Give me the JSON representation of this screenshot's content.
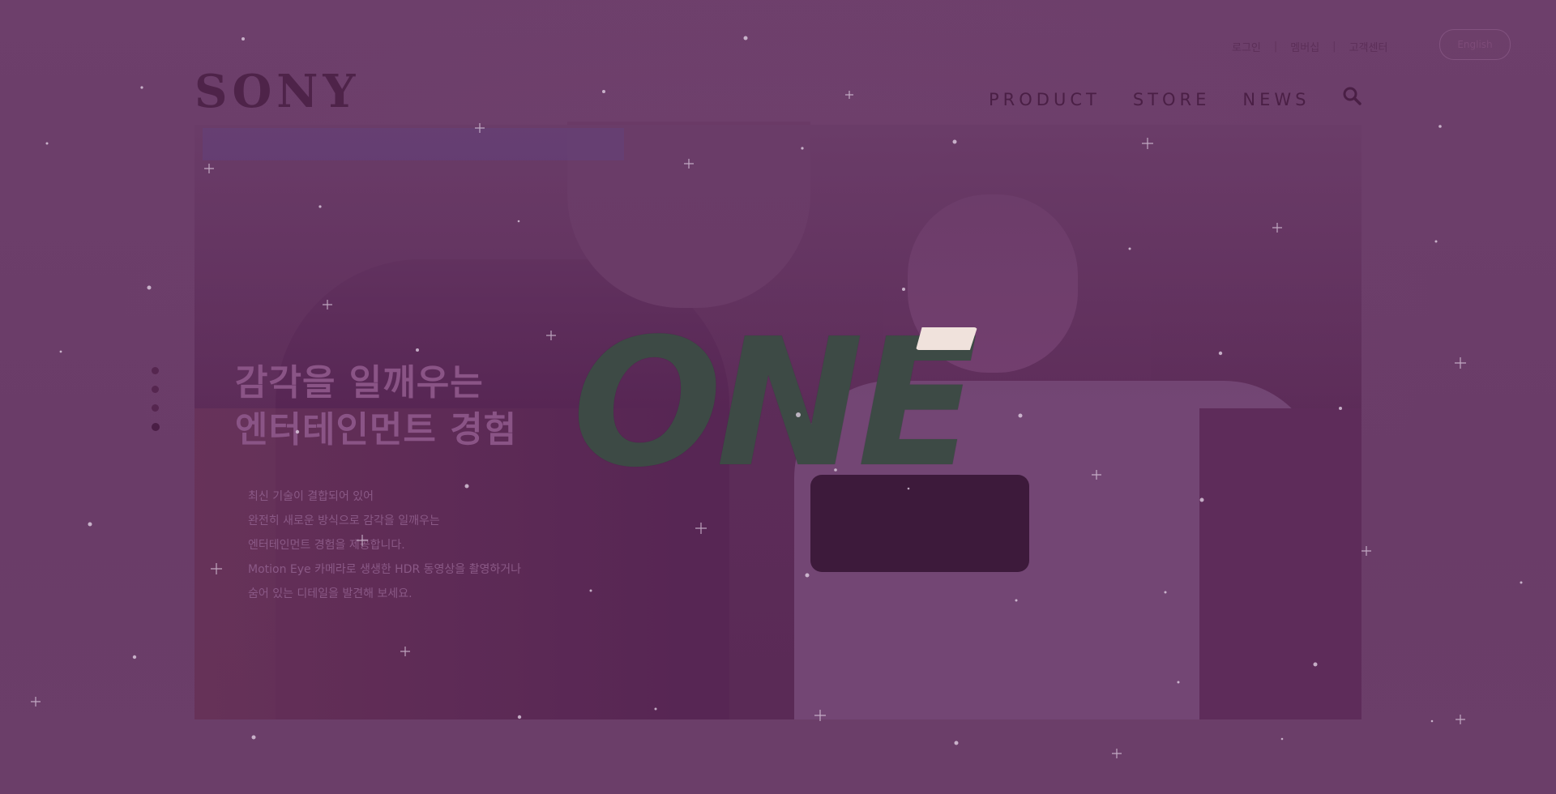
{
  "brand": {
    "logo_text": "SONY"
  },
  "top_links": {
    "login": "로그인",
    "membership": "멤버십",
    "support": "고객센터",
    "separator": "|"
  },
  "lang_button": {
    "label": "English"
  },
  "nav": {
    "items": [
      "PRODUCT",
      "STORE",
      "NEWS"
    ]
  },
  "hero": {
    "headline_line1": "감각을 일깨우는",
    "headline_line2": "엔터테인먼트 경험",
    "big_word": "ONE",
    "description": [
      "최신 기술이 결합되어 있어",
      "완전히 새로운 방식으로 감각을 일깨우는",
      "엔터테인먼트 경험을 제공합니다.",
      "Motion Eye 카메라로 생생한 HDR 동영상을 촬영하거나",
      "숨어 있는 디테일을 발견해 보세요."
    ]
  },
  "pager": {
    "count": 4,
    "active_index": 3
  },
  "icons": {
    "search": "search-icon"
  },
  "colors": {
    "background": "#6c3f6a",
    "nav_text": "#4a1f45",
    "big_word": "#3d4a45"
  }
}
